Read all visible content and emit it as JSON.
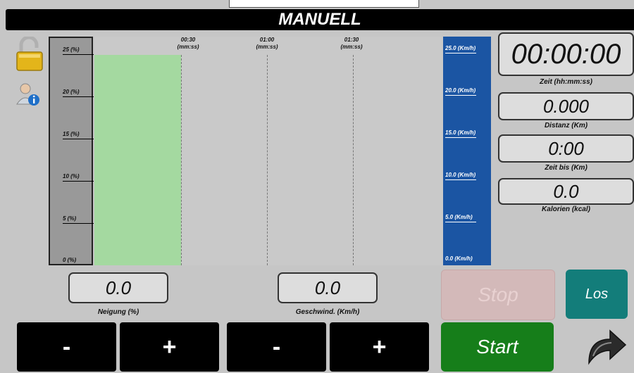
{
  "title": "MANUELL",
  "incline_axis": {
    "ticks": [
      "25 (%)",
      "20 (%)",
      "15 (%)",
      "10 (%)",
      "5 (%)",
      "0 (%)"
    ]
  },
  "time_axis": {
    "ticks": [
      {
        "time": "00:30",
        "unit": "(mm:ss)"
      },
      {
        "time": "01:00",
        "unit": "(mm:ss)"
      },
      {
        "time": "01:30",
        "unit": "(mm:ss)"
      }
    ]
  },
  "speed_axis": {
    "ticks": [
      "25.0 (Km/h)",
      "20.0 (Km/h)",
      "15.0 (Km/h)",
      "10.0 (Km/h)",
      "5.0 (Km/h)",
      "0.0 (Km/h)"
    ]
  },
  "chart_data": {
    "type": "bar",
    "categories": [
      "00:00–00:30"
    ],
    "series": [
      {
        "values": [
          25
        ]
      }
    ],
    "ylim": [
      0,
      25
    ],
    "x_ticks": [
      "00:30",
      "01:00",
      "01:30"
    ]
  },
  "stats": {
    "time": {
      "value": "00:00:00",
      "label": "Zeit (hh:mm:ss)"
    },
    "distance": {
      "value": "0.000",
      "label": "Distanz (Km)"
    },
    "time_to": {
      "value": "0:00",
      "label": "Zeit bis (Km)"
    },
    "calories": {
      "value": "0.0",
      "label": "Kalorien (kcal)"
    }
  },
  "incline": {
    "value": "0.0",
    "label": "Neigung (%)",
    "minus": "-",
    "plus": "+"
  },
  "speed": {
    "value": "0.0",
    "label": "Geschwind. (Km/h)",
    "minus": "-",
    "plus": "+"
  },
  "buttons": {
    "stop": "Stop",
    "los": "Los",
    "start": "Start"
  },
  "colors": {
    "accent_blue": "#1b55a3",
    "start_green": "#167e1a",
    "los_teal": "#137d7a",
    "bar_green": "#a4d9a0"
  },
  "icons": {
    "lock": "padlock-open-icon",
    "user": "user-info-icon",
    "forward": "forward-arrow-icon"
  }
}
